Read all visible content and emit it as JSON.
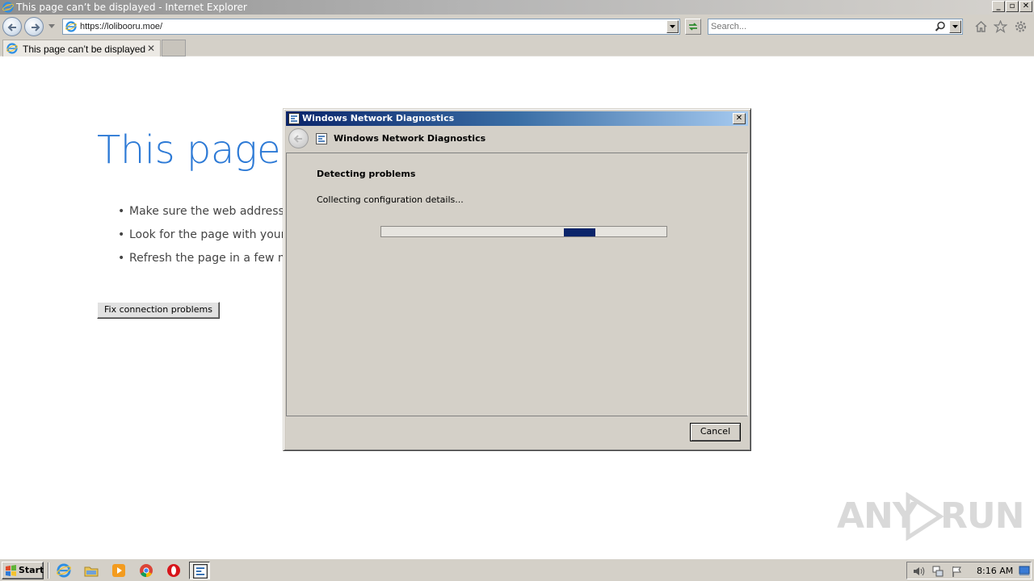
{
  "window": {
    "title": "This page can’t be displayed - Internet Explorer"
  },
  "addressbar": {
    "url": "https://lolibooru.moe/"
  },
  "searchbar": {
    "placeholder": "Search..."
  },
  "tabs": [
    {
      "label": "This page can’t be displayed",
      "active": true
    }
  ],
  "page": {
    "heading": "This page c",
    "bullets": [
      "Make sure the web address h",
      "Look for the page with your",
      "Refresh the page in a few mi"
    ],
    "fix_button": "Fix connection problems"
  },
  "dialog": {
    "title": "Windows Network Diagnostics",
    "header_title": "Windows Network Diagnostics",
    "status_heading": "Detecting problems",
    "status_detail": "Collecting configuration details...",
    "progress_marquee_position": 0.64,
    "cancel_button": "Cancel"
  },
  "watermark": {
    "text_left": "ANY",
    "text_right": "RUN"
  },
  "taskbar": {
    "start_label": "Start",
    "items": [
      "internet-explorer-icon",
      "file-explorer-icon",
      "media-player-icon",
      "chrome-icon",
      "opera-icon",
      "network-diagnostics-icon"
    ],
    "clock": "8:16 AM"
  },
  "colors": {
    "heading_blue": "#2d7ad6",
    "dialog_title_start": "#0a246a",
    "dialog_title_end": "#a6caf0",
    "progress_chunk": "#0a246a",
    "chrome_gray": "#d4d0c8"
  }
}
